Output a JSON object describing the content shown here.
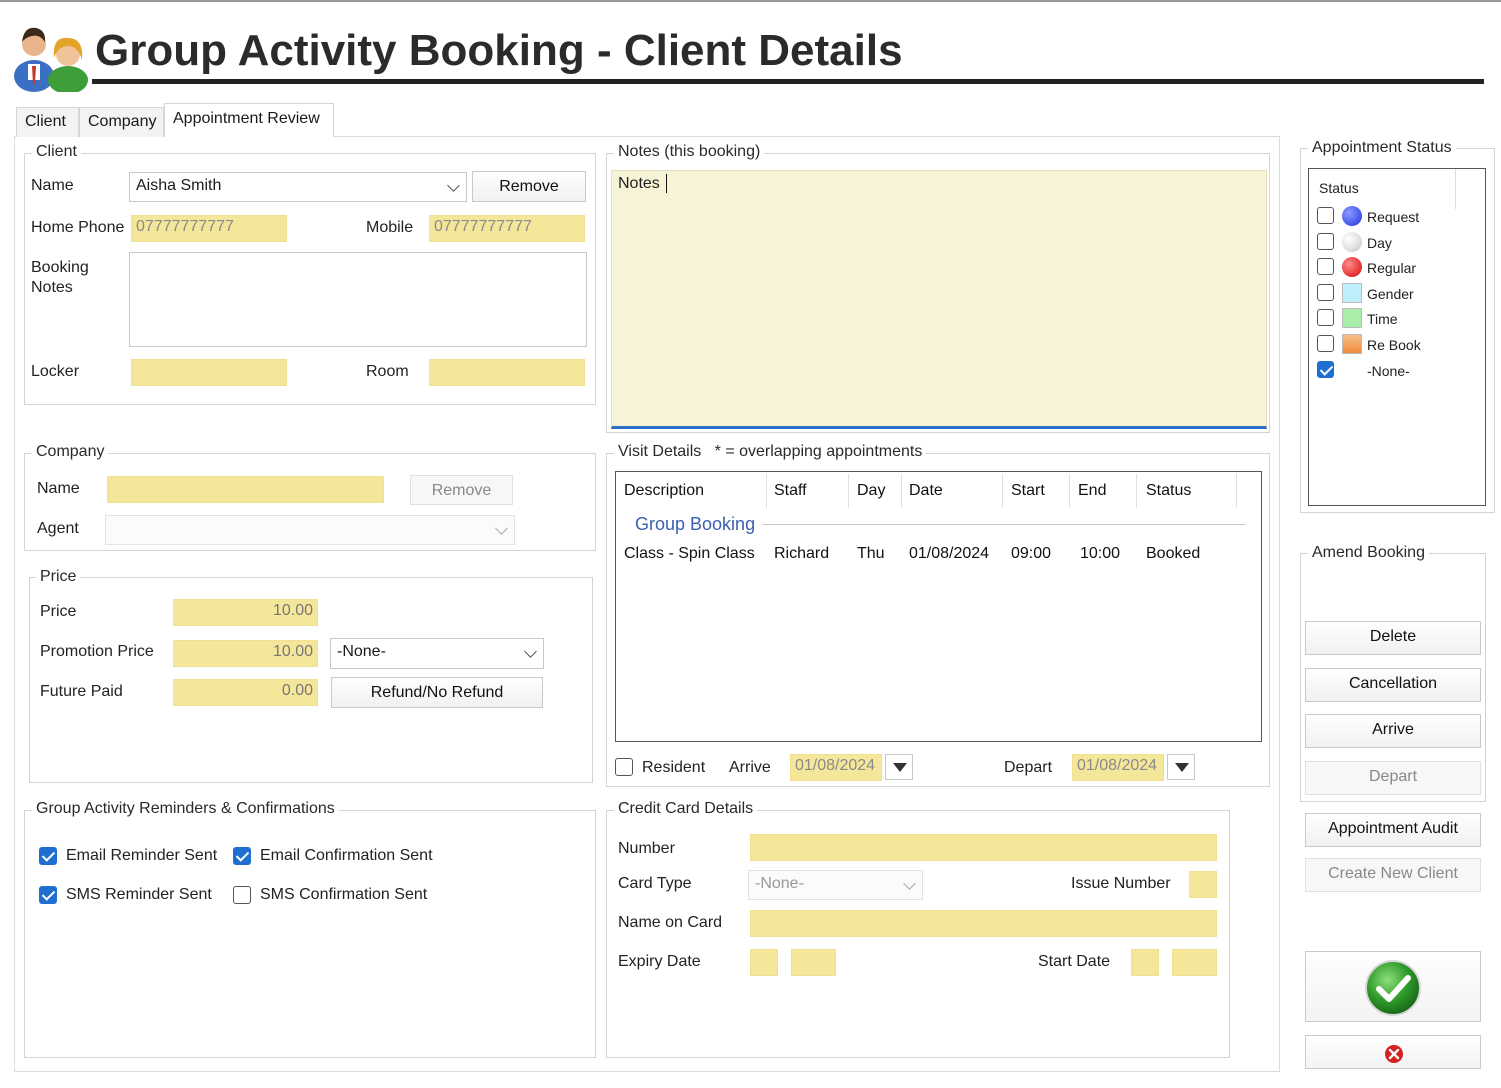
{
  "window": {
    "title": "Group Activity Booking - Client Details"
  },
  "tabs": [
    {
      "label": "Client",
      "active": false
    },
    {
      "label": "Company",
      "active": false
    },
    {
      "label": "Appointment Review",
      "active": true
    }
  ],
  "client": {
    "legend": "Client",
    "name_label": "Name",
    "name_value": "Aisha Smith",
    "remove_label": "Remove",
    "home_phone_label": "Home Phone",
    "home_phone_value": "07777777777",
    "mobile_label": "Mobile",
    "mobile_value": "07777777777",
    "booking_notes_label_1": "Booking",
    "booking_notes_label_2": "Notes",
    "booking_notes_value": "",
    "locker_label": "Locker",
    "locker_value": "",
    "room_label": "Room",
    "room_value": ""
  },
  "company": {
    "legend": "Company",
    "name_label": "Name",
    "name_value": "",
    "remove_label": "Remove",
    "agent_label": "Agent",
    "agent_value": ""
  },
  "price": {
    "legend": "Price",
    "price_label": "Price",
    "price_value": "10.00",
    "promotion_label": "Promotion Price",
    "promotion_value": "10.00",
    "promotion_option": "-None-",
    "future_paid_label": "Future Paid",
    "future_paid_value": "0.00",
    "refund_label": "Refund/No Refund"
  },
  "reminders": {
    "legend": "Group Activity Reminders & Confirmations",
    "email_reminder": {
      "label": "Email Reminder Sent",
      "checked": true
    },
    "email_confirmation": {
      "label": "Email Confirmation Sent",
      "checked": true
    },
    "sms_reminder": {
      "label": "SMS Reminder Sent",
      "checked": true
    },
    "sms_confirmation": {
      "label": "SMS Confirmation Sent",
      "checked": false
    }
  },
  "notes": {
    "legend": "Notes (this booking)",
    "value": "Notes"
  },
  "visit": {
    "legend": "Visit Details",
    "legend_note": "* = overlapping appointments",
    "columns": [
      "Description",
      "Staff",
      "Day",
      "Date",
      "Start",
      "End",
      "Status"
    ],
    "group_label": "Group Booking",
    "rows": [
      {
        "description": "Class - Spin Class",
        "staff": "Richard",
        "day": "Thu",
        "date": "01/08/2024",
        "start": "09:00",
        "end": "10:00",
        "status": "Booked"
      }
    ],
    "resident_label": "Resident",
    "arrive_label": "Arrive",
    "arrive_value": "01/08/2024",
    "depart_label": "Depart",
    "depart_value": "01/08/2024"
  },
  "credit_card": {
    "legend": "Credit Card Details",
    "number_label": "Number",
    "number_value": "",
    "card_type_label": "Card Type",
    "card_type_value": "-None-",
    "issue_number_label": "Issue Number",
    "name_on_card_label": "Name on Card",
    "expiry_label": "Expiry Date",
    "start_date_label": "Start Date"
  },
  "appointment_status": {
    "legend": "Appointment Status",
    "header": "Status",
    "items": [
      {
        "label": "Request",
        "color": "#4a5cf0",
        "shape": "circle",
        "checked": false
      },
      {
        "label": "Day",
        "color": "#dedede",
        "shape": "circle",
        "checked": false
      },
      {
        "label": "Regular",
        "color": "#e83a3a",
        "shape": "circle",
        "checked": false
      },
      {
        "label": "Gender",
        "color": "#bfeefc",
        "shape": "square",
        "checked": false
      },
      {
        "label": "Time",
        "color": "#a9eda9",
        "shape": "square",
        "checked": false
      },
      {
        "label": "Re Book",
        "color": "#f5a45a",
        "shape": "square",
        "checked": false
      },
      {
        "label": "-None-",
        "color": "",
        "shape": "none",
        "checked": true
      }
    ]
  },
  "amend": {
    "legend": "Amend Booking",
    "delete_label": "Delete",
    "cancellation_label": "Cancellation",
    "arrive_label": "Arrive",
    "depart_label": "Depart"
  },
  "actions": {
    "audit_label": "Appointment Audit",
    "create_client_label": "Create New Client"
  }
}
